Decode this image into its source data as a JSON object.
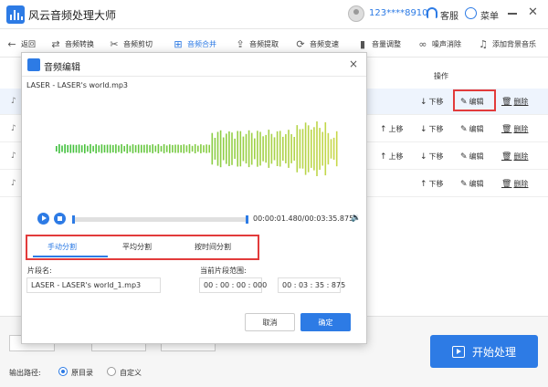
{
  "app": {
    "title": "风云音频处理大师",
    "user_phone": "123****8910",
    "support_label": "客服",
    "menu_label": "菜单"
  },
  "toolbar": [
    {
      "label": "返回",
      "icon": "back-arrow-icon"
    },
    {
      "label": "音频转换",
      "icon": "convert-icon"
    },
    {
      "label": "音频剪切",
      "icon": "scissors-icon"
    },
    {
      "label": "音频合并",
      "icon": "merge-icon",
      "active": true
    },
    {
      "label": "音频提取",
      "icon": "extract-icon"
    },
    {
      "label": "音频变速",
      "icon": "speed-icon"
    },
    {
      "label": "音量调整",
      "icon": "volume-bars-icon"
    },
    {
      "label": "噪声消除",
      "icon": "noise-icon"
    },
    {
      "label": "添加背景音乐",
      "icon": "music-note-icon"
    }
  ],
  "list": {
    "ops_header": "操作",
    "labels": {
      "up": "上移",
      "down": "下移",
      "edit": "编辑",
      "delete": "删除"
    }
  },
  "dialog": {
    "title": "音频编辑",
    "close": "×",
    "file_name": "LASER - LASER's world.mp3",
    "time": "00:00:01.480/00:03:35.875",
    "progress": 0.01,
    "tabs": [
      "手动分割",
      "平均分割",
      "按时间分割"
    ],
    "active_tab": 0,
    "segment_name_label": "片段名:",
    "segment_name_value": "LASER - LASER's world_1.mp3",
    "range_label": "当前片段范围:",
    "range_start": "00 : 00 : 00 : 000",
    "range_end": "00 : 03 : 35 : 875",
    "cancel": "取消",
    "confirm": "确定"
  },
  "bottom": {
    "output_label": "输出路径:",
    "option_original": "原目录",
    "option_custom": "自定义",
    "start_label": "开始处理"
  },
  "colors": {
    "accent": "#2d7be5",
    "highlight": "#e23b3b",
    "wave_start": "#3cbf3c",
    "wave_end": "#c8d84a"
  }
}
